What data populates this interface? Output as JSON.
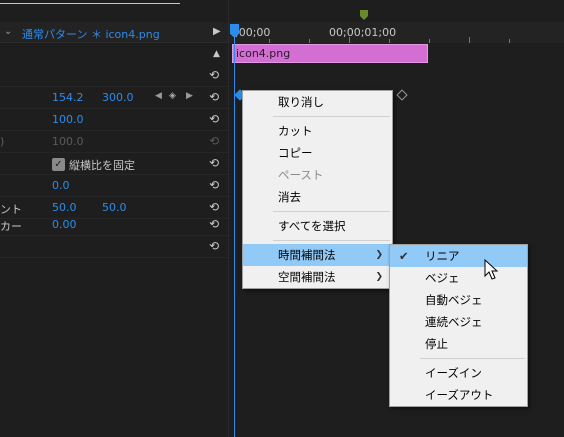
{
  "header": {
    "title": "通常パターン ＊ icon4.png"
  },
  "rows": [
    {
      "label": "",
      "v1": "154.2",
      "v2": "300.0"
    },
    {
      "label": "",
      "v1": "100.0",
      "v2": ""
    },
    {
      "label": ")",
      "v1": "100.0",
      "v2": ""
    },
    {
      "label": "",
      "checkbox_label": "縦横比を固定"
    },
    {
      "label": "",
      "v1": "0.0",
      "v2": ""
    },
    {
      "label": "ント",
      "v1": "50.0",
      "v2": "50.0"
    },
    {
      "label": "カー",
      "v1": "0.00",
      "v2": ""
    }
  ],
  "timeline": {
    "tc_start": ";00;00",
    "tc_mid": "00;00;01;00",
    "clip_name": "icon4.png"
  },
  "context_menu": {
    "items": [
      "取り消し",
      "カット",
      "コピー",
      "ペースト",
      "消去",
      "すべてを選択",
      "時間補間法",
      "空間補間法"
    ]
  },
  "submenu": {
    "items": [
      "リニア",
      "ベジェ",
      "自動ベジェ",
      "連続ベジェ",
      "停止",
      "イーズイン",
      "イーズアウト"
    ],
    "checked": "リニア"
  },
  "colors": {
    "accent": "#2d8ceb",
    "clip": "#d36fd3",
    "highlight": "#91c9f7"
  }
}
